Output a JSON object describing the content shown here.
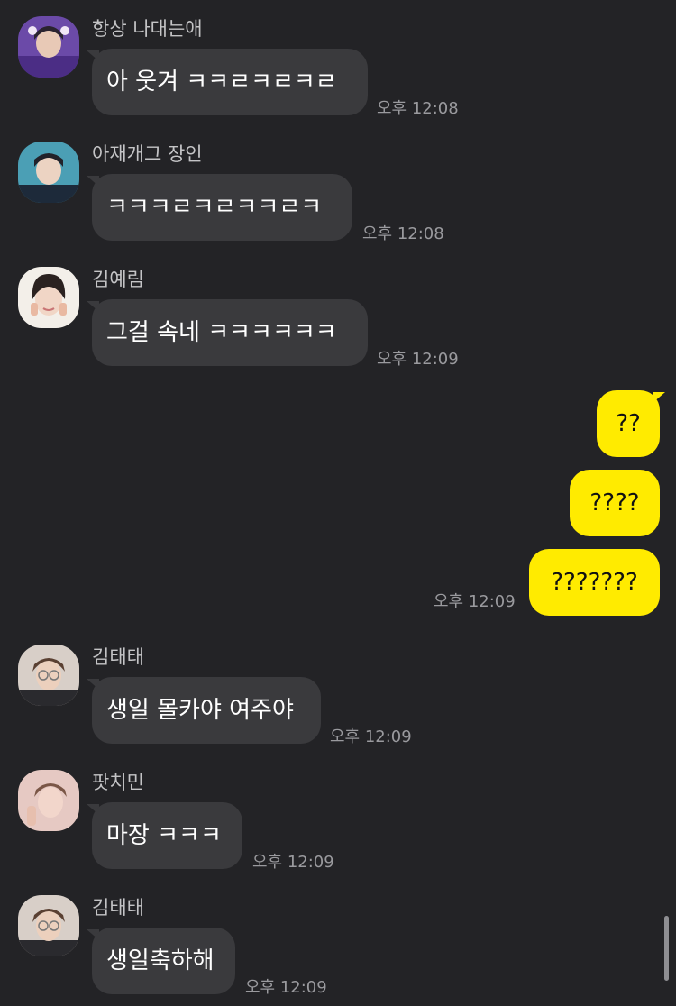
{
  "messages": [
    {
      "sender": "항상 나대는애",
      "text": "아 웃겨 ㅋㅋㄹㅋㄹㅋㄹ",
      "time": "오후 12:08"
    },
    {
      "sender": "아재개그 장인",
      "text": "ㅋㅋㅋㄹㅋㄹㅋㅋㄹㅋ",
      "time": "오후 12:08"
    },
    {
      "sender": "김예림",
      "text": "그걸 속네 ㅋㅋㅋㅋㅋㅋ",
      "time": "오후 12:09"
    },
    {
      "text": "??"
    },
    {
      "text": "????"
    },
    {
      "text": "???????",
      "time": "오후 12:09"
    },
    {
      "sender": "김태태",
      "text": "생일 몰카야 여주야",
      "time": "오후 12:09"
    },
    {
      "sender": "팟치민",
      "text": "마장 ㅋㅋㅋ",
      "time": "오후 12:09"
    },
    {
      "sender": "김태태",
      "text": "생일축하해",
      "time": "오후 12:09"
    }
  ],
  "colors": {
    "background": "#232326",
    "incoming_bubble": "#3a3a3d",
    "outgoing_bubble": "#ffeb00",
    "timestamp": "#9a9a9e"
  }
}
